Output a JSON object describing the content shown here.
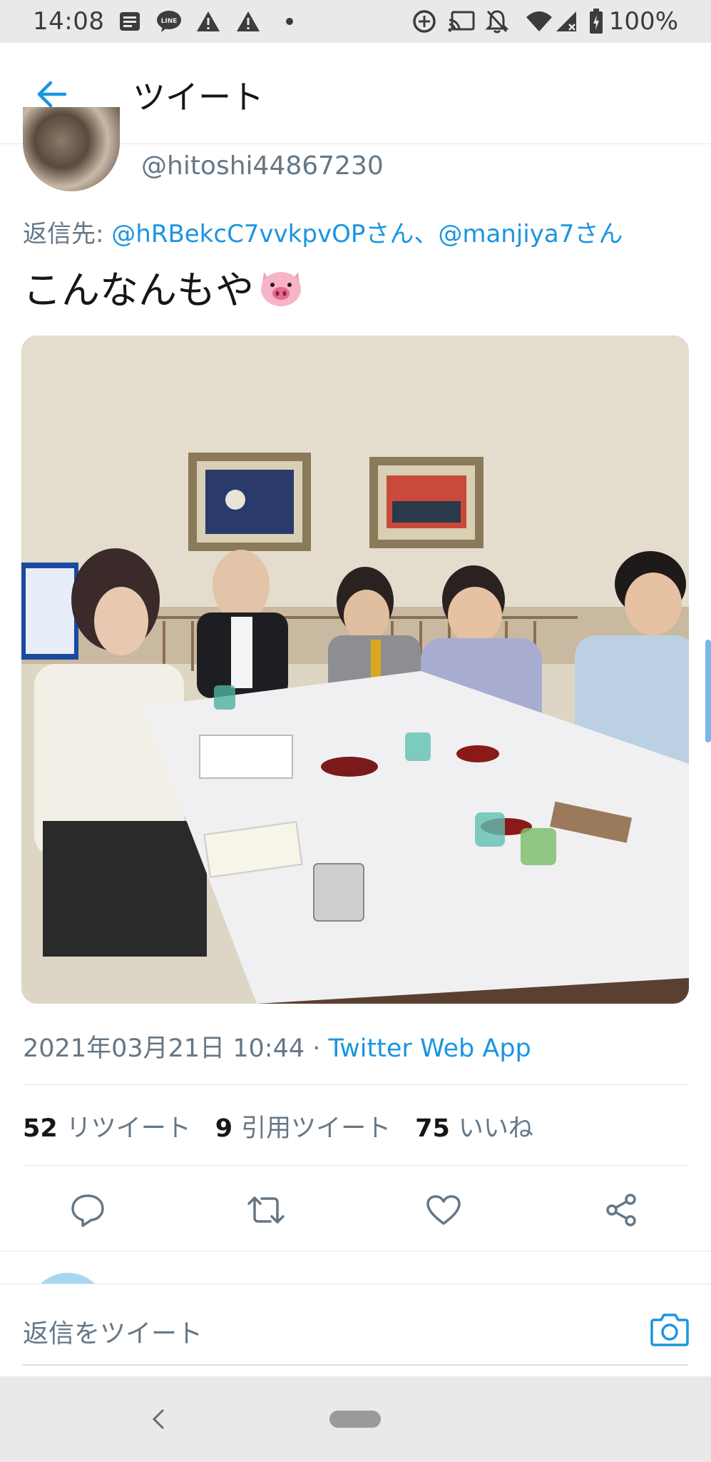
{
  "status_bar": {
    "time": "14:08",
    "battery": "100%"
  },
  "header": {
    "title": "ツイート"
  },
  "tweet": {
    "handle": "@hitoshi44867230",
    "reply_prefix": "返信先: ",
    "reply_user1": "@hRBekcC7vvkpvOPさん",
    "reply_sep": "、",
    "reply_user2": "@manjiya7さん",
    "text": "こんなんもや",
    "emoji": "pig-face",
    "timestamp": "2021年03月21日 10:44 · ",
    "source": "Twitter Web App",
    "stats": {
      "retweets": "52",
      "retweets_label": "リツイート",
      "quotes": "9",
      "quotes_label": "引用ツイート",
      "likes": "75",
      "likes_label": "いいね"
    }
  },
  "actions": [
    "reply-icon",
    "retweet-icon",
    "like-icon",
    "share-icon"
  ],
  "reply_bar": {
    "placeholder": "返信をツイート"
  },
  "colors": {
    "accent": "#1b95e0",
    "muted": "#657786",
    "text": "#14171a",
    "divider": "#e1e8ed"
  }
}
